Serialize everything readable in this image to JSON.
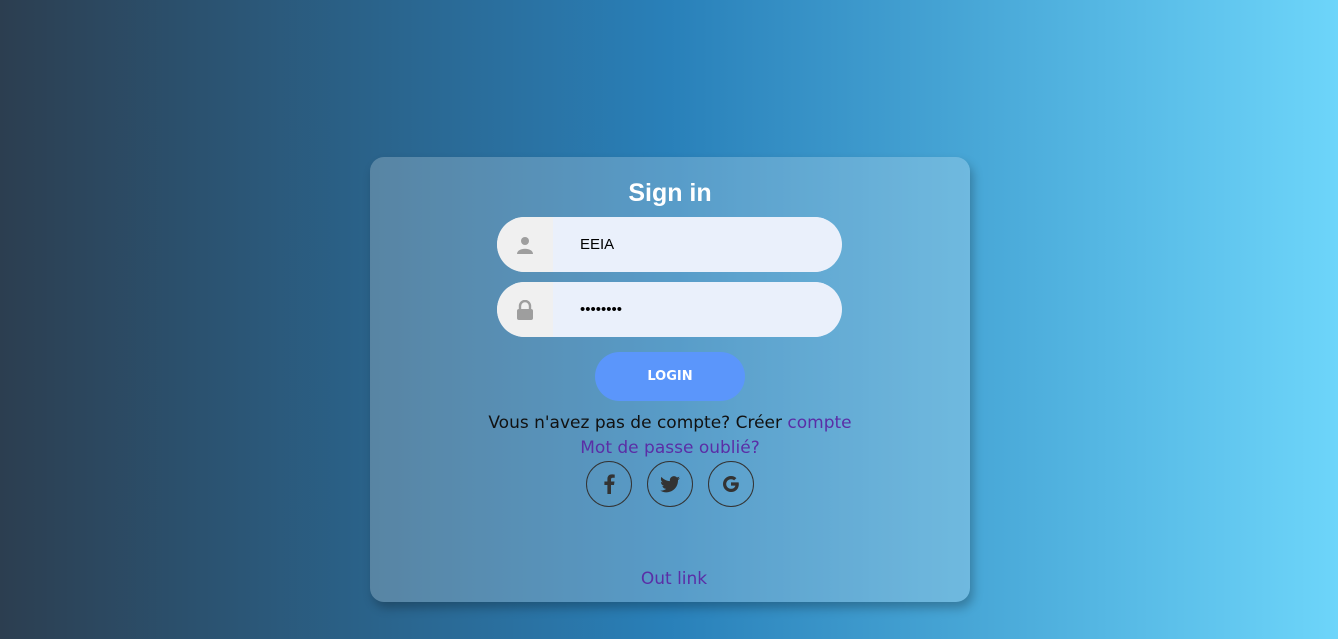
{
  "form": {
    "title": "Sign in",
    "username": {
      "value": "EEIA",
      "icon": "user-icon"
    },
    "password": {
      "value": "••••••••",
      "icon": "lock-icon"
    },
    "login_label": "LOGIN"
  },
  "signup": {
    "prompt": "Vous n'avez pas de compte? Créer ",
    "link": "compte"
  },
  "forgot": "Mot de passe oublié?",
  "socials": [
    "facebook-icon",
    "twitter-icon",
    "google-icon"
  ],
  "out_link": "Out link",
  "colors": {
    "gradient_start": "#2c3e50",
    "gradient_mid": "#2980b9",
    "gradient_end": "#6dd5fa",
    "button": "#5b96fb",
    "link": "#5a2ea6"
  }
}
